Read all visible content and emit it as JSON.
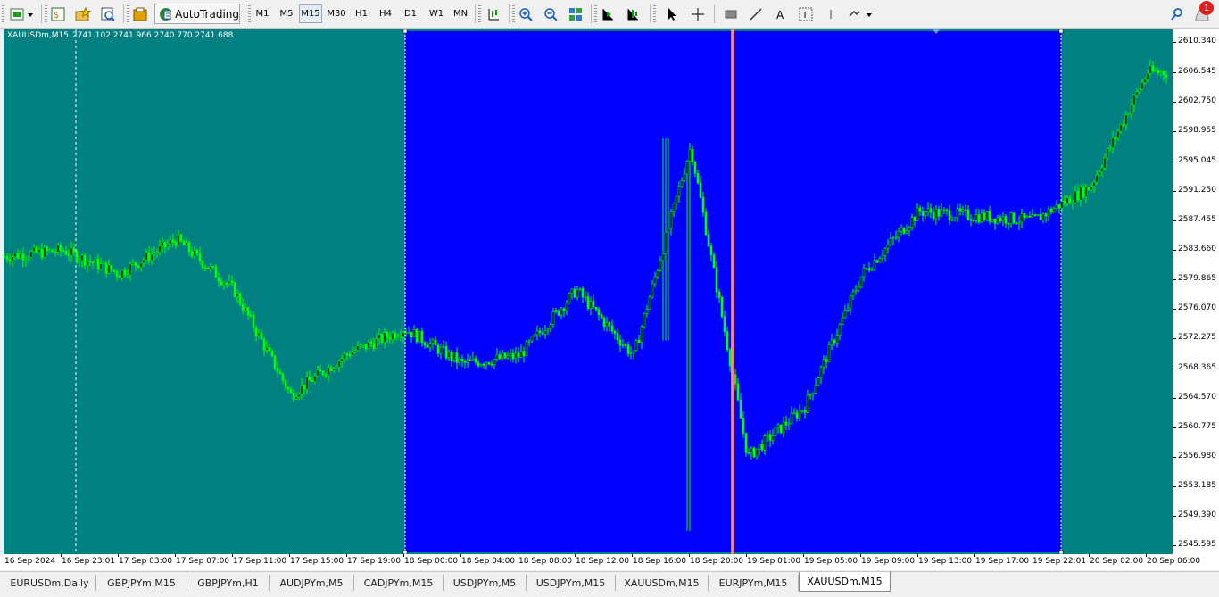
{
  "toolbar": {
    "autotrading_label": "AutoTrading",
    "timeframes": [
      "M1",
      "M5",
      "M15",
      "M30",
      "H1",
      "H4",
      "D1",
      "W1",
      "MN"
    ],
    "active_timeframe": "M15",
    "notification_count": "1"
  },
  "chart": {
    "symbol": "XAUUSDm,M15",
    "ohlc": "2741.102 2741.966 2740.770 2741.688",
    "background": "#008080",
    "selection_color": "#0000ff",
    "candle_color": "#00ff00",
    "marker_color": "#ff8080"
  },
  "price_axis": [
    "2610.340",
    "2606.545",
    "2602.750",
    "2598.955",
    "2595.045",
    "2591.250",
    "2587.455",
    "2583.660",
    "2579.865",
    "2576.070",
    "2572.275",
    "2568.365",
    "2564.570",
    "2560.775",
    "2556.980",
    "2553.185",
    "2549.390",
    "2545.595"
  ],
  "time_axis": [
    "16 Sep 2024",
    "16 Sep 23:01",
    "17 Sep 03:00",
    "17 Sep 07:00",
    "17 Sep 11:00",
    "17 Sep 15:00",
    "17 Sep 19:00",
    "18 Sep 00:00",
    "18 Sep 04:00",
    "18 Sep 08:00",
    "18 Sep 12:00",
    "18 Sep 16:00",
    "18 Sep 20:00",
    "19 Sep 01:00",
    "19 Sep 05:00",
    "19 Sep 09:00",
    "19 Sep 13:00",
    "19 Sep 17:00",
    "19 Sep 22:01",
    "20 Sep 02:00",
    "20 Sep 06:00"
  ],
  "tabs": [
    "EURUSDm,Daily",
    "GBPJPYm,M15",
    "GBPJPYm,H1",
    "AUDJPYm,M5",
    "CADJPYm,M15",
    "USDJPYm,M5",
    "USDJPYm,M15",
    "XAUUSDm,M15",
    "EURJPYm,M15",
    "XAUUSDm,M15"
  ],
  "active_tab_index": 9,
  "chart_data": {
    "type": "line",
    "ylim": [
      2544.5,
      2612.0
    ],
    "x": [
      "16 Sep 2024",
      "16 Sep 23:01",
      "17 Sep 03:00",
      "17 Sep 07:00",
      "17 Sep 11:00",
      "17 Sep 15:00",
      "17 Sep 19:00",
      "18 Sep 00:00",
      "18 Sep 04:00",
      "18 Sep 08:00",
      "18 Sep 12:00",
      "18 Sep 16:00",
      "18 Sep 20:00",
      "19 Sep 01:00",
      "19 Sep 05:00",
      "19 Sep 09:00",
      "19 Sep 13:00",
      "19 Sep 17:00",
      "19 Sep 22:01",
      "20 Sep 02:00",
      "20 Sep 06:00"
    ],
    "series": [
      {
        "values": [
          2582.8,
          2583.6,
          2580.6,
          2585.0,
          2578.5,
          2565.0,
          2570.3,
          2573.5,
          2569.0,
          2570.0,
          2578.5,
          2570.0,
          2597.0,
          2557.0,
          2563.5,
          2580.5,
          2588.6,
          2588.0,
          2587.4,
          2591.8,
          2606.5
        ]
      }
    ]
  }
}
